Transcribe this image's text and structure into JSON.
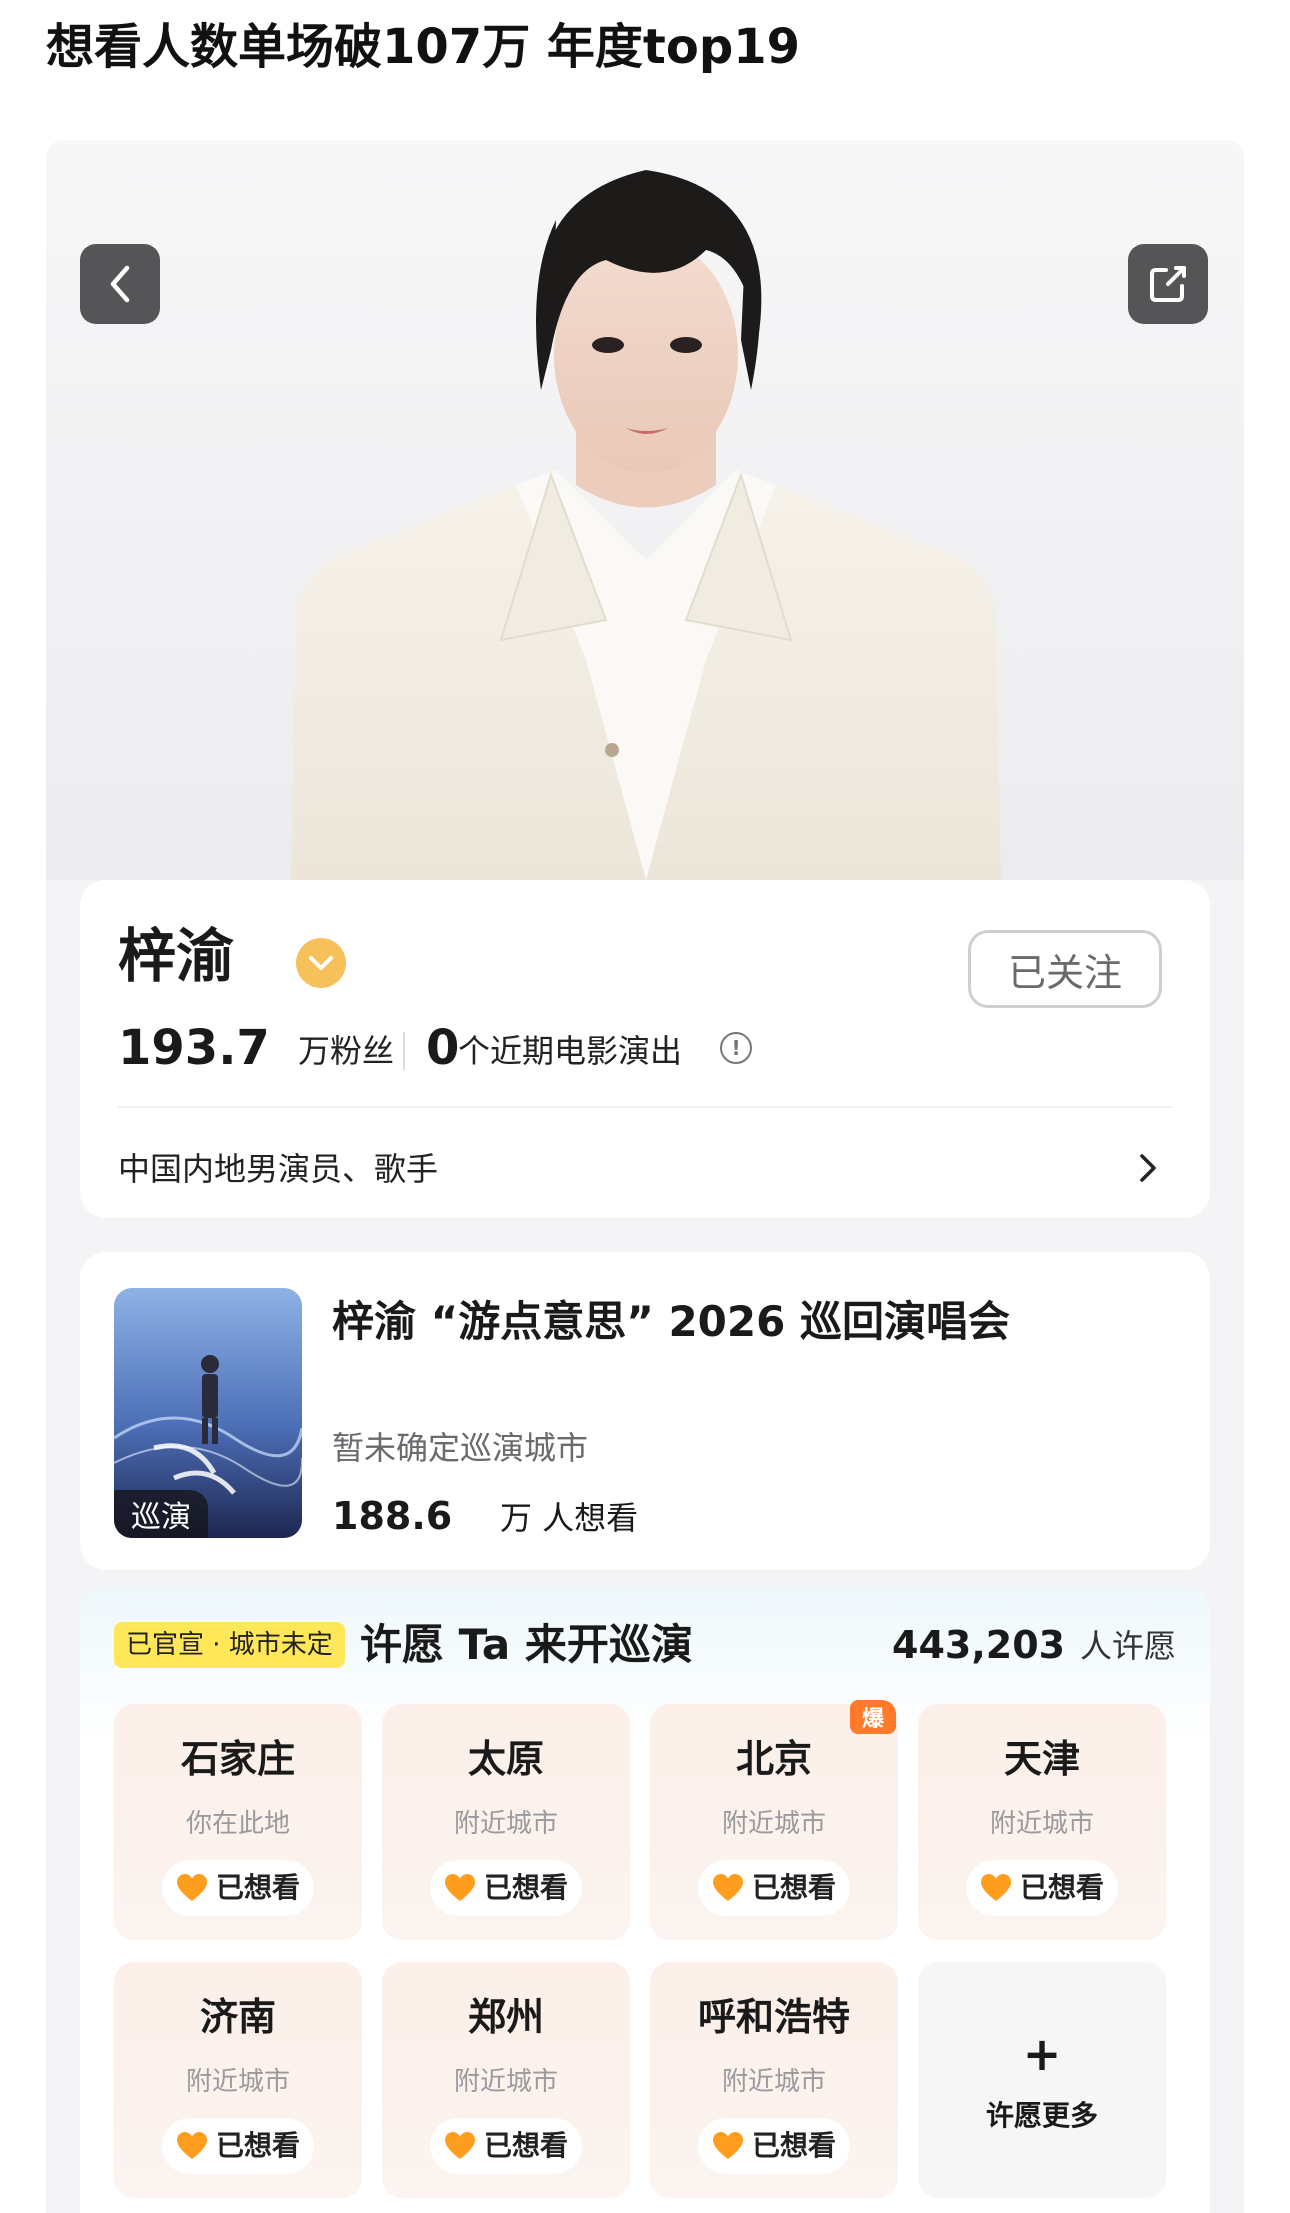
{
  "post_title": "想看人数单场破107万 年度top19",
  "profile": {
    "name": "梓渝",
    "follow_label": "已关注",
    "fans_count": "193.7",
    "fans_label": "万粉丝",
    "shows_count": "0",
    "shows_label": "个近期电影演出",
    "bio": "中国内地男演员、歌手"
  },
  "concert": {
    "title": "梓渝 “游点意思” 2026 巡回演唱会",
    "tag": "巡演",
    "status": "暂未确定巡演城市",
    "want_count": "188.6",
    "want_label": "万 人想看"
  },
  "wish": {
    "badge": "已官宣 · 城市未定",
    "title": "许愿 Ta 来开巡演",
    "count": "443,203",
    "count_label": "人许愿",
    "want_label": "已想看",
    "hot_label": "爆",
    "more_plus": "+",
    "more_label": "许愿更多",
    "cities": [
      {
        "name": "石家庄",
        "sub": "你在此地"
      },
      {
        "name": "太原",
        "sub": "附近城市"
      },
      {
        "name": "北京",
        "sub": "附近城市",
        "hot": true
      },
      {
        "name": "天津",
        "sub": "附近城市"
      },
      {
        "name": "济南",
        "sub": "附近城市"
      },
      {
        "name": "郑州",
        "sub": "附近城市"
      },
      {
        "name": "呼和浩特",
        "sub": "附近城市"
      }
    ]
  },
  "colors": {
    "verified_badge": "#f6c15a",
    "wish_badge": "#ffe75a",
    "hot_tag": "#ff7a2a",
    "heart": "#ff9d1f"
  },
  "icons": [
    "back-arrow-icon",
    "share-icon",
    "verified-icon",
    "info-icon",
    "chevron-right-icon",
    "heart-icon",
    "plus-icon"
  ]
}
